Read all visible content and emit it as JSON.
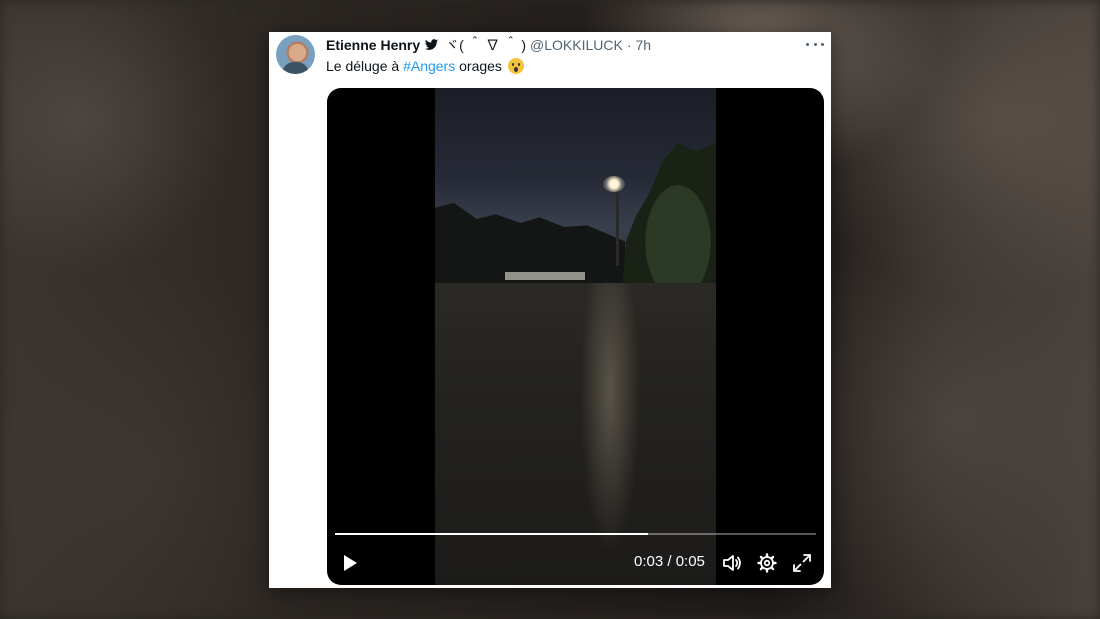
{
  "tweet": {
    "author_name": "Etienne Henry",
    "kaomoji": "ヾ( ＾ ∇ ＾ )",
    "handle": "@LOKKILUCK",
    "separator": "·",
    "time": "7h",
    "text_before": "Le déluge à ",
    "hashtag": "#Angers",
    "text_after": " orages "
  },
  "icons": {
    "verified": "twitter-bird-icon",
    "more": "more-options-icon",
    "emoji": "scream-emoji-icon",
    "play": "play-icon",
    "volume": "volume-icon",
    "settings": "gear-icon",
    "fullscreen": "fullscreen-icon"
  },
  "video": {
    "current_time": "0:03",
    "duration": "0:05",
    "time_display": "0:03 / 0:05",
    "progress": 0.65
  },
  "colors": {
    "hashtag": "#1d9bf0",
    "secondary_text": "#536471",
    "primary_text": "#0f1419"
  }
}
